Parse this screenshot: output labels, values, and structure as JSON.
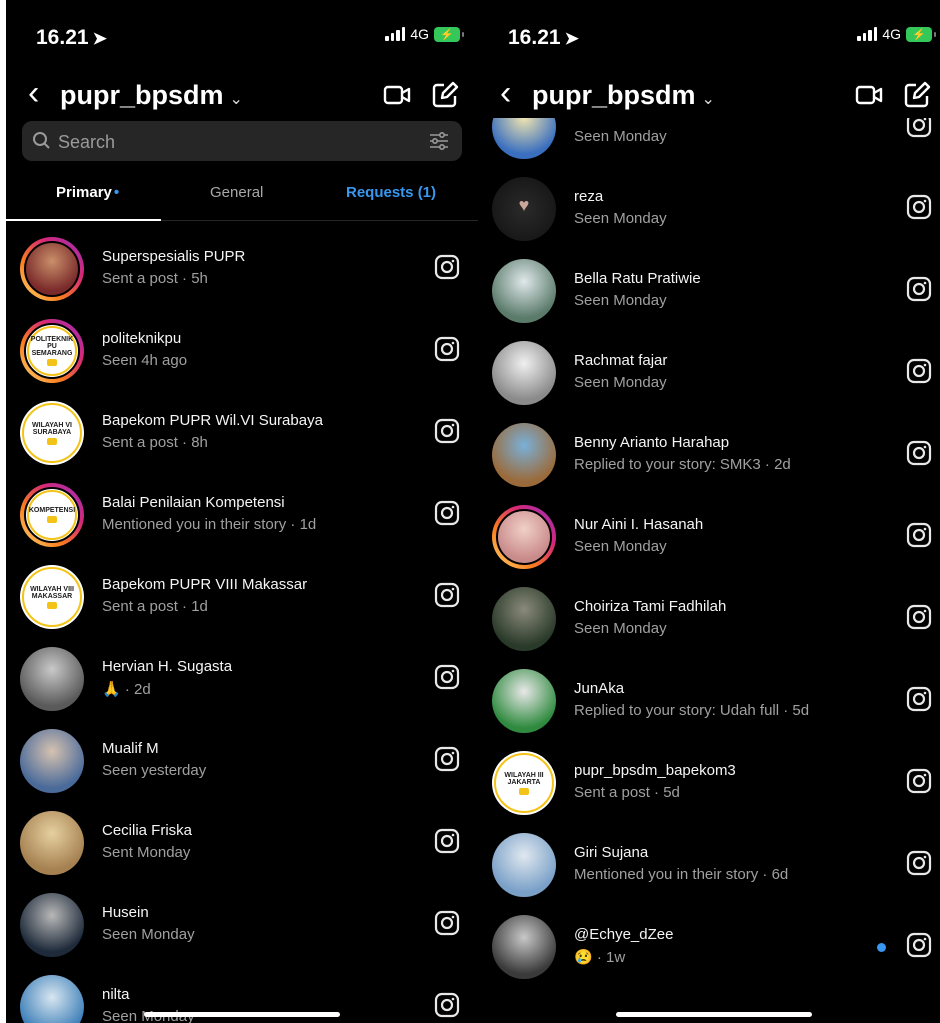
{
  "left": {
    "status_time": "16.21",
    "network": "4G",
    "account": "pupr_bpsdm",
    "search_placeholder": "Search",
    "tabs": {
      "primary": "Primary",
      "general": "General",
      "requests": "Requests (1)"
    },
    "rows": [
      {
        "name": "Superspesialis PUPR",
        "sub": "Sent a post · 5h",
        "ring": true,
        "avatar": "photo-event",
        "colors": [
          "#7a2a2a",
          "#c98f6a"
        ]
      },
      {
        "name": "politeknikpu",
        "sub": "Seen 4h ago",
        "ring": true,
        "avatar": "logo",
        "logo_text": "POLITEKNIK PU SEMARANG"
      },
      {
        "name": "Bapekom PUPR Wil.VI Surabaya",
        "sub": "Sent a post · 8h",
        "ring": false,
        "avatar": "logo",
        "logo_text": "WILAYAH VI SURABAYA"
      },
      {
        "name": "Balai Penilaian Kompetensi",
        "sub": "Mentioned you in their story · 1d",
        "ring": true,
        "avatar": "logo",
        "logo_text": "KOMPETENSI"
      },
      {
        "name": "Bapekom PUPR VIII Makassar",
        "sub": "Sent a post · 1d",
        "ring": false,
        "avatar": "logo",
        "logo_text": "WILAYAH VIII MAKASSAR"
      },
      {
        "name": "Hervian H. Sugasta",
        "sub": "🙏 · 2d",
        "ring": false,
        "avatar": "photo",
        "colors": [
          "#5a5a5a",
          "#c9c9c9"
        ]
      },
      {
        "name": "Mualif M",
        "sub": "Seen yesterday",
        "ring": false,
        "avatar": "photo",
        "colors": [
          "#4a6a9a",
          "#d6c2b0"
        ]
      },
      {
        "name": "Cecilia Friska",
        "sub": "Sent Monday",
        "ring": false,
        "avatar": "photo",
        "colors": [
          "#a58050",
          "#e6d0a0"
        ]
      },
      {
        "name": "Husein",
        "sub": "Seen Monday",
        "ring": false,
        "avatar": "photo",
        "colors": [
          "#1e2a3a",
          "#b8b8b8"
        ]
      },
      {
        "name": "nilta",
        "sub": "Seen Monday",
        "ring": false,
        "avatar": "photo",
        "colors": [
          "#3d7fb8",
          "#d8e6f0"
        ]
      }
    ]
  },
  "right": {
    "status_time": "16.21",
    "network": "4G",
    "account": "pupr_bpsdm",
    "rows": [
      {
        "name": "",
        "sub": "Seen Monday",
        "ring": false,
        "avatar": "photo",
        "colors": [
          "#3a6fbf",
          "#f2e6b0"
        ]
      },
      {
        "name": "reza",
        "sub": "Seen Monday",
        "ring": false,
        "avatar": "heart",
        "colors": [
          "#1a1a1a",
          "#2a2a2a"
        ]
      },
      {
        "name": "Bella Ratu Pratiwie",
        "sub": "Seen Monday",
        "ring": false,
        "avatar": "photo",
        "colors": [
          "#5a7a6a",
          "#dfe8ea"
        ]
      },
      {
        "name": "Rachmat fajar",
        "sub": "Seen Monday",
        "ring": false,
        "avatar": "photo",
        "colors": [
          "#8a8a8a",
          "#f0f0f0"
        ]
      },
      {
        "name": "Benny Arianto Harahap",
        "sub": "Replied to your story: SMK3 · 2d",
        "ring": false,
        "avatar": "photo",
        "colors": [
          "#9a6a3a",
          "#7ab0d8"
        ]
      },
      {
        "name": "Nur Aini I. Hasanah",
        "sub": "Seen Monday",
        "ring": true,
        "avatar": "photo",
        "colors": [
          "#c98a8a",
          "#f0d0c8"
        ]
      },
      {
        "name": "Choiriza Tami Fadhilah",
        "sub": "Seen Monday",
        "ring": false,
        "avatar": "photo",
        "colors": [
          "#2a3a2a",
          "#8a8a7a"
        ]
      },
      {
        "name": "JunAka",
        "sub": "Replied to your story: Udah full · 5d",
        "ring": false,
        "avatar": "photo",
        "colors": [
          "#2f8a3f",
          "#e8e8e8"
        ]
      },
      {
        "name": "pupr_bpsdm_bapekom3",
        "sub": "Sent a post · 5d",
        "ring": false,
        "avatar": "logo",
        "logo_text": "WILAYAH III JAKARTA"
      },
      {
        "name": "Giri Sujana",
        "sub": "Mentioned you in their story · 6d",
        "ring": false,
        "avatar": "photo",
        "colors": [
          "#7aa0c8",
          "#e0e8ef"
        ]
      },
      {
        "name": "@Echye_dZee",
        "sub": "😢 · 1w",
        "ring": false,
        "avatar": "photo",
        "colors": [
          "#3a3a3a",
          "#c8c8c8"
        ],
        "unread": true
      }
    ]
  },
  "colors": {
    "accent": "#3897f0",
    "bg": "#000000",
    "secondary_text": "#a0a0a0"
  },
  "icons": [
    "back-chevron-icon",
    "video-call-icon",
    "compose-icon",
    "search-icon",
    "filter-icon",
    "camera-icon"
  ]
}
